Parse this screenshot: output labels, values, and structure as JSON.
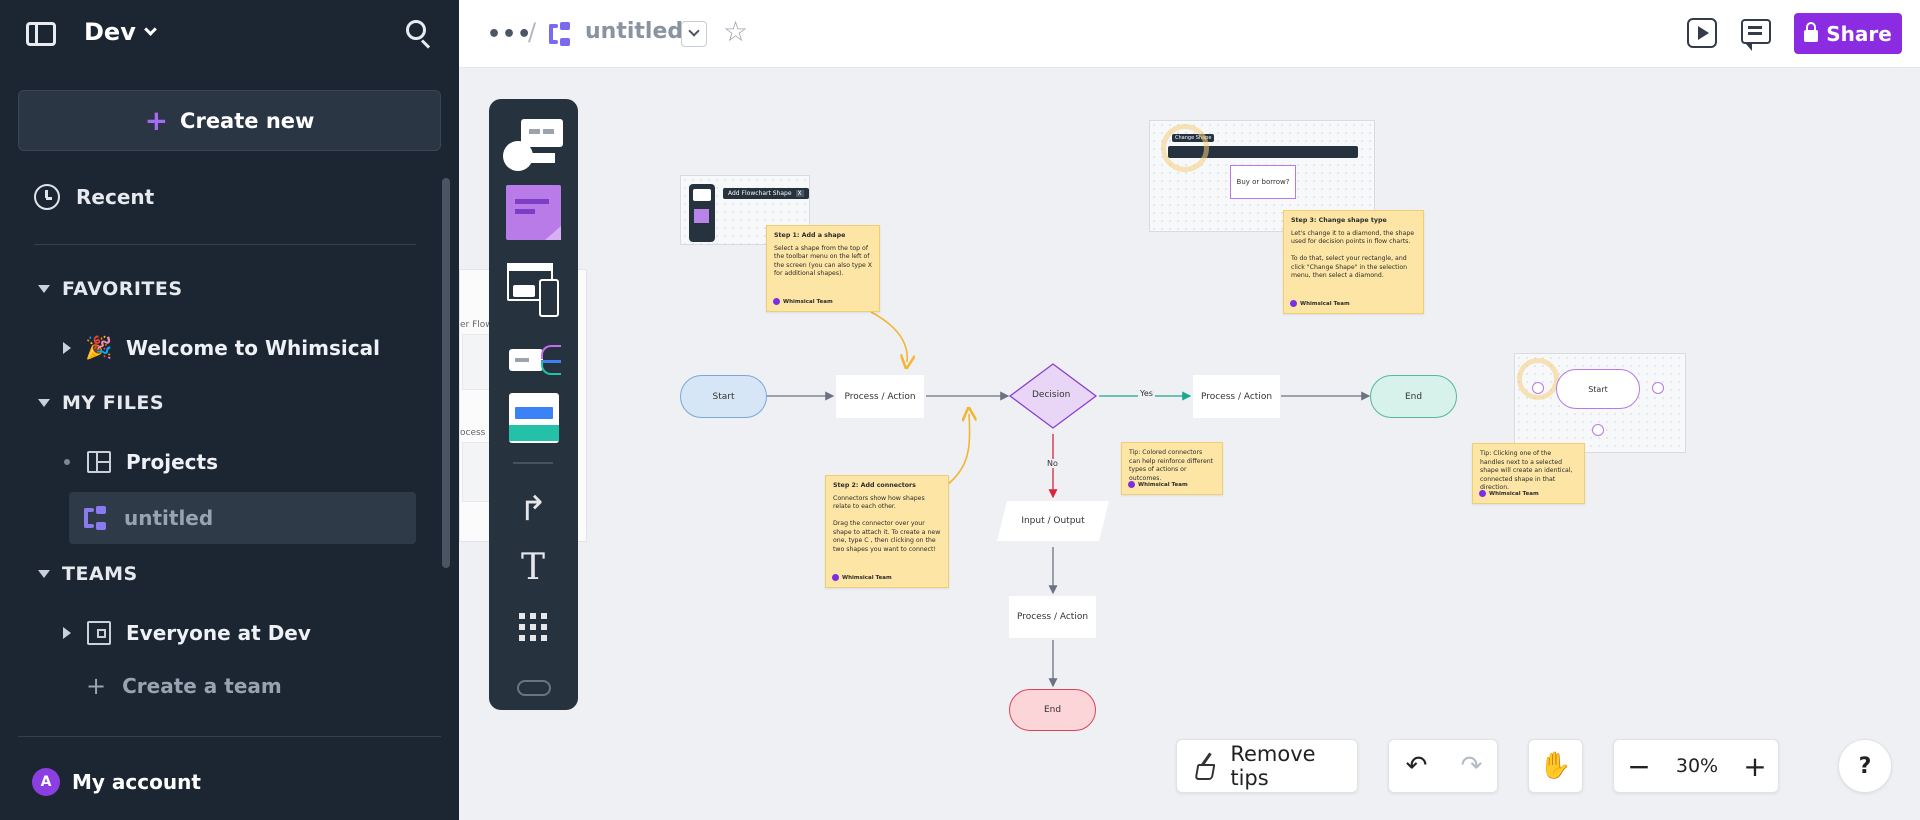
{
  "sidebar": {
    "workspace": "Dev",
    "create_new": "Create new",
    "recent": "Recent",
    "sections": {
      "favorites": "FAVORITES",
      "my_files": "MY FILES",
      "teams": "TEAMS"
    },
    "favorites": [
      {
        "label": "Welcome to Whimsical",
        "icon": "party-icon"
      }
    ],
    "my_files": [
      {
        "label": "Projects",
        "icon": "board-icon"
      },
      {
        "label": "untitled",
        "icon": "flowchart-icon",
        "active": true
      }
    ],
    "teams": [
      {
        "label": "Everyone at Dev",
        "icon": "building-icon"
      }
    ],
    "create_team": "Create a team",
    "account": {
      "label": "My account",
      "initial": "A"
    }
  },
  "topbar": {
    "more": "•••",
    "separator": "/",
    "doc_title": "untitled",
    "share_label": "Share",
    "accent": "#8b2be2"
  },
  "canvas": {
    "ghost_frame": {
      "label_1": "er Flow",
      "label_2": "ocess Fl"
    },
    "tooltip_add_shape": "Add Flowchart Shape",
    "tooltip_add_shape_key": "X",
    "tooltip_change_shape": "Change Shape",
    "frame_buy_or_borrow": "Buy or borrow?",
    "frame_start": "Start",
    "flow": {
      "start": "Start",
      "process_1": "Process / Action",
      "decision": "Decision",
      "process_2": "Process / Action",
      "end_1": "End",
      "input_output": "Input / Output",
      "process_3": "Process / Action",
      "end_2": "End",
      "yes": "Yes",
      "no": "No"
    },
    "stickies": {
      "step1": {
        "title": "Step 1: Add a shape",
        "body": "Select a shape from the top of the toolbar menu on the left of the screen (you can also type X for additional shapes).",
        "team": "Whimsical Team"
      },
      "step2": {
        "title": "Step 2: Add connectors",
        "body1": "Connectors show how shapes relate to each other.",
        "body2": "Drag the connector over your shape to attach it. To create a new one, type C , then clicking on the two shapes you want to connect!",
        "team": "Whimsical Team"
      },
      "step3": {
        "title": "Step 3: Change shape type",
        "body1": "Let's change it to a diamond, the shape used for decision points in flow charts.",
        "body2": "To do that, select your rectangle, and click \"Change Shape\" in the selection menu, then select a diamond.",
        "team": "Whimsical Team"
      },
      "tip_colored": {
        "body": "Tip: Colored connectors can help reinforce different types of actions or outcomes.",
        "team": "Whimsical Team"
      },
      "tip_handles": {
        "body": "Tip: Clicking one of the handles next to a selected shape will create an identical, connected shape in that direction.",
        "team": "Whimsical Team"
      }
    },
    "colors": {
      "start_fill": "#d6e6f7",
      "end_fill": "#d7f2ea",
      "end2_fill": "#fbd5d8",
      "decision_fill": "#e9d6f7",
      "yes_connector": "#1aa890",
      "no_connector": "#d9243a",
      "curve": "#f4b531"
    }
  },
  "controls": {
    "remove_tips": "Remove tips",
    "zoom": "30%",
    "zoom_minus": "−",
    "zoom_plus": "+",
    "help": "?",
    "undo": "↶",
    "redo": "↷"
  }
}
